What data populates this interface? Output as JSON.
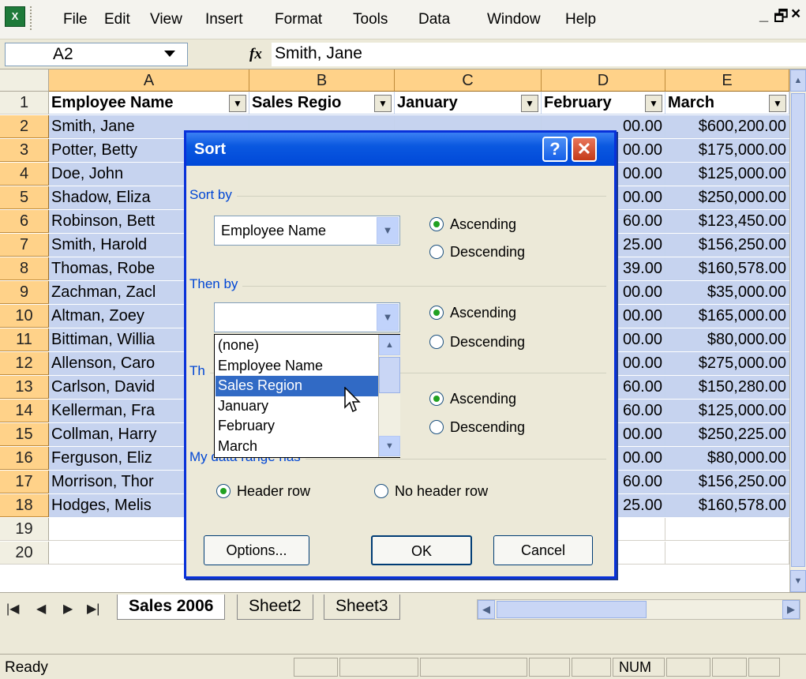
{
  "menu": {
    "items": [
      "File",
      "Edit",
      "View",
      "Insert",
      "Format",
      "Tools",
      "Data",
      "Window",
      "Help"
    ],
    "min_glyph": "_",
    "max_glyph": "🗗",
    "close_glyph": "×"
  },
  "formula_bar": {
    "name_box": "A2",
    "fx_label": "fx",
    "content": "Smith, Jane"
  },
  "grid": {
    "columns": [
      "A",
      "B",
      "C",
      "D",
      "E"
    ],
    "header_row": [
      "Employee Name",
      "Sales Regio",
      "January",
      "February",
      "March"
    ],
    "rows": [
      {
        "num": "2",
        "name": "Smith, Jane",
        "d": "00.00",
        "e": "$600,200.00"
      },
      {
        "num": "3",
        "name": "Potter, Betty",
        "d": "00.00",
        "e": "$175,000.00"
      },
      {
        "num": "4",
        "name": "Doe, John",
        "d": "00.00",
        "e": "$125,000.00"
      },
      {
        "num": "5",
        "name": "Shadow, Eliza",
        "d": "00.00",
        "e": "$250,000.00"
      },
      {
        "num": "6",
        "name": "Robinson, Bett",
        "d": "60.00",
        "e": "$123,450.00"
      },
      {
        "num": "7",
        "name": "Smith, Harold",
        "d": "25.00",
        "e": "$156,250.00"
      },
      {
        "num": "8",
        "name": "Thomas, Robe",
        "d": "39.00",
        "e": "$160,578.00"
      },
      {
        "num": "9",
        "name": "Zachman, Zacl",
        "d": "00.00",
        "e": "$35,000.00"
      },
      {
        "num": "10",
        "name": "Altman, Zoey",
        "d": "00.00",
        "e": "$165,000.00"
      },
      {
        "num": "11",
        "name": "Bittiman, Willia",
        "d": "00.00",
        "e": "$80,000.00"
      },
      {
        "num": "12",
        "name": "Allenson, Caro",
        "d": "00.00",
        "e": "$275,000.00"
      },
      {
        "num": "13",
        "name": "Carlson, David",
        "d": "60.00",
        "e": "$150,280.00"
      },
      {
        "num": "14",
        "name": "Kellerman, Fra",
        "d": "60.00",
        "e": "$125,000.00"
      },
      {
        "num": "15",
        "name": "Collman, Harry",
        "d": "00.00",
        "e": "$250,225.00"
      },
      {
        "num": "16",
        "name": "Ferguson, Eliz",
        "d": "00.00",
        "e": "$80,000.00"
      },
      {
        "num": "17",
        "name": "Morrison, Thor",
        "d": "60.00",
        "e": "$156,250.00"
      },
      {
        "num": "18",
        "name": "Hodges, Melis",
        "d": "25.00",
        "e": "$160,578.00"
      }
    ],
    "extra_rows": [
      "19",
      "20"
    ]
  },
  "tabs": {
    "nav": [
      "|◀",
      "◀",
      "▶",
      "▶|"
    ],
    "sheets": [
      "Sales 2006",
      "Sheet2",
      "Sheet3"
    ],
    "active": "Sales 2006"
  },
  "status": {
    "ready": "Ready",
    "num": "NUM"
  },
  "dialog": {
    "title": "Sort",
    "help_glyph": "?",
    "close_glyph": "✕",
    "sort_by_label": "Sort by",
    "sort_by_value": "Employee Name",
    "then_by_label": "Then by",
    "then_by_value": "",
    "then_by2_label": "Th",
    "range_label": "My data range has",
    "ascending": "Ascending",
    "descending": "Descending",
    "header_row": "Header row",
    "no_header_row": "No header row",
    "options": "Options...",
    "ok": "OK",
    "cancel": "Cancel",
    "dropdown_items": [
      "(none)",
      "Employee Name",
      "Sales Region",
      "January",
      "February",
      "March"
    ],
    "dropdown_selected": "Sales Region"
  },
  "colors": {
    "title_bar": "#0a58e0",
    "selected_header": "#ffd289",
    "highlight": "#c6d3ef",
    "list_selection": "#316ac5",
    "group_label": "#0046d5"
  }
}
